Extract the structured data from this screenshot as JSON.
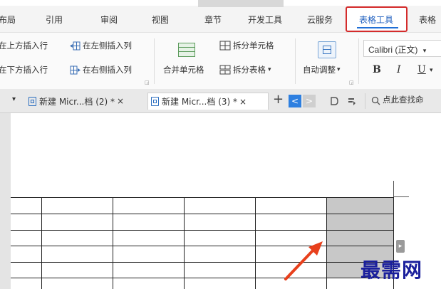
{
  "tabs": [
    {
      "label": "布局"
    },
    {
      "label": "引用"
    },
    {
      "label": "审阅"
    },
    {
      "label": "视图"
    },
    {
      "label": "章节"
    },
    {
      "label": "开发工具"
    },
    {
      "label": "云服务"
    },
    {
      "label": "表格工具",
      "active": true
    },
    {
      "label": "表格"
    }
  ],
  "ribbon": {
    "insert_above": "在上方插入行",
    "insert_left": "在左侧插入列",
    "insert_below": "在下方插入行",
    "insert_right": "在右侧插入列",
    "merge_cells": "合并单元格",
    "split_cells": "拆分单元格",
    "split_table": "拆分表格",
    "split_table_caret": "▾",
    "auto_fit": "自动调整",
    "auto_fit_caret": "▾",
    "font_name": "Calibri (正文)",
    "font_caret": "▾",
    "bold": "B",
    "italic": "I",
    "underline": "U",
    "underline_caret": "▾"
  },
  "doc_tabs": {
    "dropdown": "▾",
    "tabs": [
      {
        "label": "新建 Micr...档 (2) *",
        "close": "×",
        "active": false
      },
      {
        "label": "新建 Micr...档 (3) *",
        "close": "×",
        "active": true
      }
    ],
    "add": "+",
    "prev": "<",
    "next": ">",
    "search": "点此查找命"
  },
  "watermark": "最需网",
  "colors": {
    "highlight_box": "#d42b2b",
    "active_tab_text": "#1f5fbf",
    "arrow": "#e8401c",
    "watermark": "#1a1f9c",
    "selection": "#c8c8c8"
  }
}
